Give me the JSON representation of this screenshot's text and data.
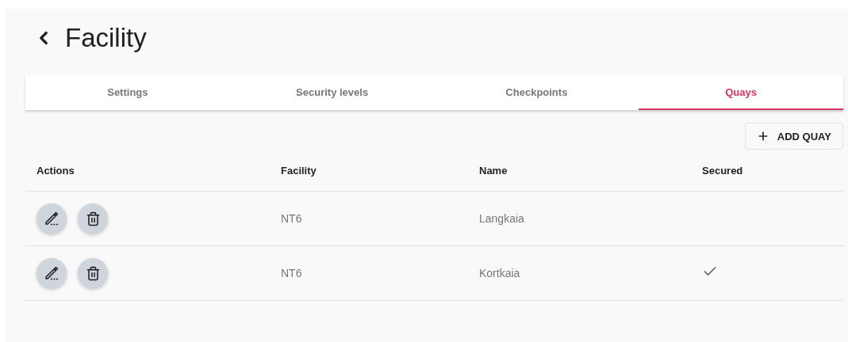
{
  "title": "Facility",
  "tabs": [
    {
      "label": "Settings",
      "selected": false
    },
    {
      "label": "Security levels",
      "selected": false
    },
    {
      "label": "Checkpoints",
      "selected": false
    },
    {
      "label": "Quays",
      "selected": true
    }
  ],
  "add_button": {
    "label": "ADD QUAY"
  },
  "table": {
    "columns": [
      "Actions",
      "Facility",
      "Name",
      "Secured"
    ],
    "rows": [
      {
        "facility": "NT6",
        "name": "Langkaia",
        "secured": false
      },
      {
        "facility": "NT6",
        "name": "Kortkaia",
        "secured": true
      }
    ]
  }
}
